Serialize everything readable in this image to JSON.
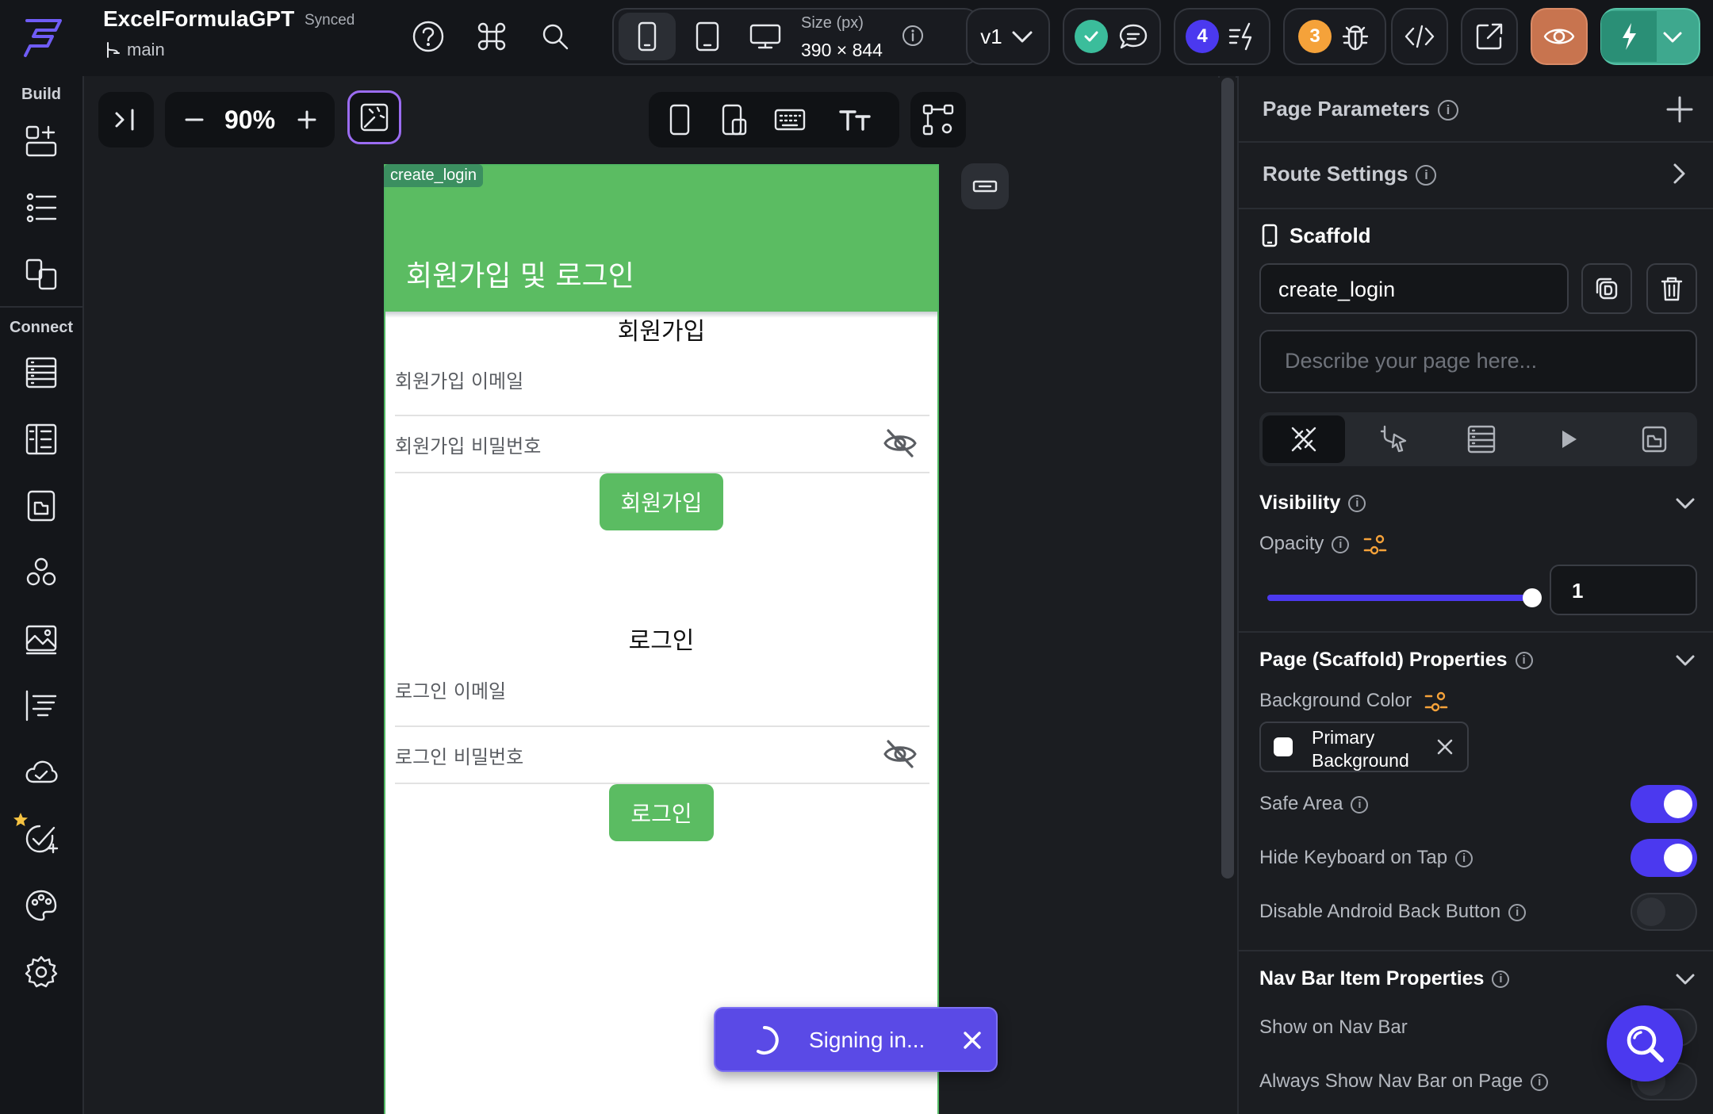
{
  "app": {
    "name": "ExcelFormulaGPT",
    "sync_status": "Synced",
    "branch": "main"
  },
  "topbar": {
    "size_label": "Size (px)",
    "size_value": "390 × 844",
    "version": "v1",
    "issues_count": "4",
    "bugs_count": "3"
  },
  "leftrail": {
    "build_label": "Build",
    "connect_label": "Connect"
  },
  "canvas": {
    "zoom": "90%"
  },
  "phone": {
    "page_tag": "create_login",
    "appbar_title": "회원가입 및 로그인",
    "signup": {
      "title": "회원가입",
      "email_label": "회원가입 이메일",
      "password_label": "회원가입 비밀번호",
      "button": "회원가입"
    },
    "login": {
      "title": "로그인",
      "email_label": "로그인 이메일",
      "password_label": "로그인 비밀번호",
      "button": "로그인"
    }
  },
  "toast": {
    "text": "Signing in..."
  },
  "panel": {
    "page_parameters": "Page Parameters",
    "route_settings": "Route Settings",
    "widget_type": "Scaffold",
    "page_name": "create_login",
    "description_placeholder": "Describe your page here...",
    "visibility": "Visibility",
    "opacity_label": "Opacity",
    "opacity_value": "1",
    "opacity_fraction": 1.0,
    "scaffold_props": "Page (Scaffold) Properties",
    "bg_color_label": "Background Color",
    "bg_color_line1": "Primary",
    "bg_color_line2": "Background",
    "safe_area": "Safe Area",
    "hide_keyboard": "Hide Keyboard on Tap",
    "disable_back": "Disable Android Back Button",
    "nav_bar_props": "Nav Bar Item Properties",
    "show_nav": "Show on Nav Bar",
    "always_show_nav": "Always Show Nav Bar on Page"
  },
  "colors": {
    "accent": "#4b39ef",
    "green": "#5bbc62",
    "orange": "#f5a23a",
    "active_preview": "#c8744f"
  }
}
